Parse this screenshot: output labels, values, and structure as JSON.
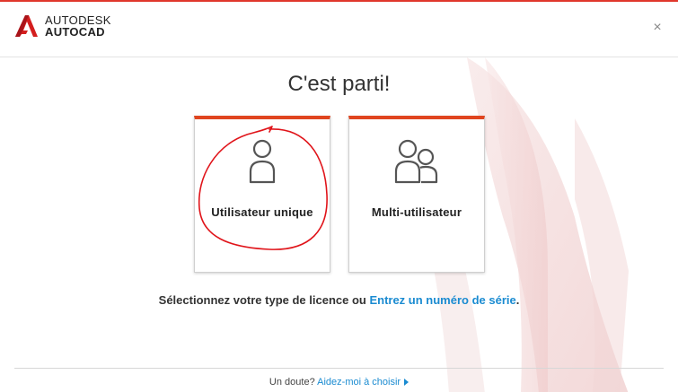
{
  "header": {
    "brand": "AUTODESK",
    "product": "AUTOCAD",
    "close_symbol": "×",
    "logo_icon": "autodesk-a-icon"
  },
  "main": {
    "title": "C'est parti!",
    "cards": [
      {
        "label": "Utilisateur unique",
        "icon": "single-user-icon"
      },
      {
        "label": "Multi-utilisateur",
        "icon": "multi-user-icon"
      }
    ],
    "prompt_text": "Sélectionnez votre type de licence ou ",
    "prompt_link": "Entrez un numéro de série",
    "prompt_end": "."
  },
  "footer": {
    "text": "Un doute? ",
    "link": "Aidez-moi à choisir"
  },
  "colors": {
    "accent": "#e0451f",
    "link": "#1a8bd1",
    "annotation": "#e0141a"
  }
}
